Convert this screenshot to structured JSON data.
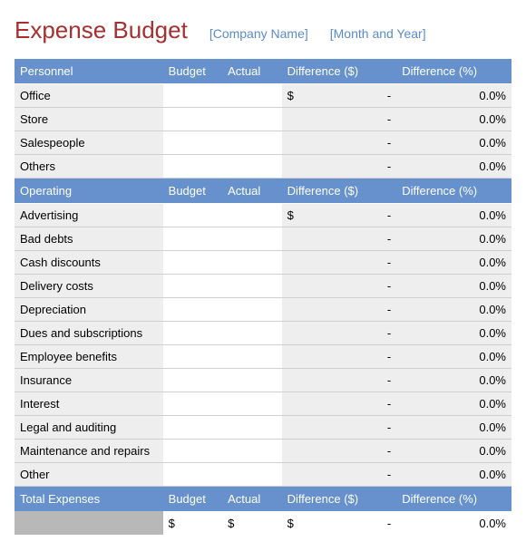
{
  "header": {
    "title": "Expense Budget",
    "company_placeholder": "[Company Name]",
    "period_placeholder": "[Month and Year]"
  },
  "columns": {
    "budget": "Budget",
    "actual": "Actual",
    "diff_dollar": "Difference ($)",
    "diff_percent": "Difference (%)"
  },
  "sections": [
    {
      "name": "Personnel",
      "rows": [
        {
          "label": "Office",
          "budget": "",
          "actual": "",
          "diff_prefix": "$",
          "diff_value": "-",
          "diff_pct": "0.0%"
        },
        {
          "label": "Store",
          "budget": "",
          "actual": "",
          "diff_prefix": "",
          "diff_value": "-",
          "diff_pct": "0.0%"
        },
        {
          "label": "Salespeople",
          "budget": "",
          "actual": "",
          "diff_prefix": "",
          "diff_value": "-",
          "diff_pct": "0.0%"
        },
        {
          "label": "Others",
          "budget": "",
          "actual": "",
          "diff_prefix": "",
          "diff_value": "-",
          "diff_pct": "0.0%"
        }
      ]
    },
    {
      "name": "Operating",
      "rows": [
        {
          "label": "Advertising",
          "budget": "",
          "actual": "",
          "diff_prefix": "$",
          "diff_value": "-",
          "diff_pct": "0.0%"
        },
        {
          "label": "Bad debts",
          "budget": "",
          "actual": "",
          "diff_prefix": "",
          "diff_value": "-",
          "diff_pct": "0.0%"
        },
        {
          "label": "Cash discounts",
          "budget": "",
          "actual": "",
          "diff_prefix": "",
          "diff_value": "-",
          "diff_pct": "0.0%"
        },
        {
          "label": "Delivery costs",
          "budget": "",
          "actual": "",
          "diff_prefix": "",
          "diff_value": "-",
          "diff_pct": "0.0%"
        },
        {
          "label": "Depreciation",
          "budget": "",
          "actual": "",
          "diff_prefix": "",
          "diff_value": "-",
          "diff_pct": "0.0%"
        },
        {
          "label": "Dues and subscriptions",
          "budget": "",
          "actual": "",
          "diff_prefix": "",
          "diff_value": "-",
          "diff_pct": "0.0%"
        },
        {
          "label": "Employee benefits",
          "budget": "",
          "actual": "",
          "diff_prefix": "",
          "diff_value": "-",
          "diff_pct": "0.0%"
        },
        {
          "label": "Insurance",
          "budget": "",
          "actual": "",
          "diff_prefix": "",
          "diff_value": "-",
          "diff_pct": "0.0%"
        },
        {
          "label": "Interest",
          "budget": "",
          "actual": "",
          "diff_prefix": "",
          "diff_value": "-",
          "diff_pct": "0.0%"
        },
        {
          "label": "Legal and auditing",
          "budget": "",
          "actual": "",
          "diff_prefix": "",
          "diff_value": "-",
          "diff_pct": "0.0%"
        },
        {
          "label": "Maintenance and repairs",
          "budget": "",
          "actual": "",
          "diff_prefix": "",
          "diff_value": "-",
          "diff_pct": "0.0%"
        },
        {
          "label": "Other",
          "budget": "",
          "actual": "",
          "diff_prefix": "",
          "diff_value": "-",
          "diff_pct": "0.0%"
        }
      ]
    }
  ],
  "total": {
    "label": "Total  Expenses",
    "budget": "$",
    "actual": "$",
    "diff_prefix": "$",
    "diff_value": "-",
    "diff_pct": "0.0%"
  }
}
